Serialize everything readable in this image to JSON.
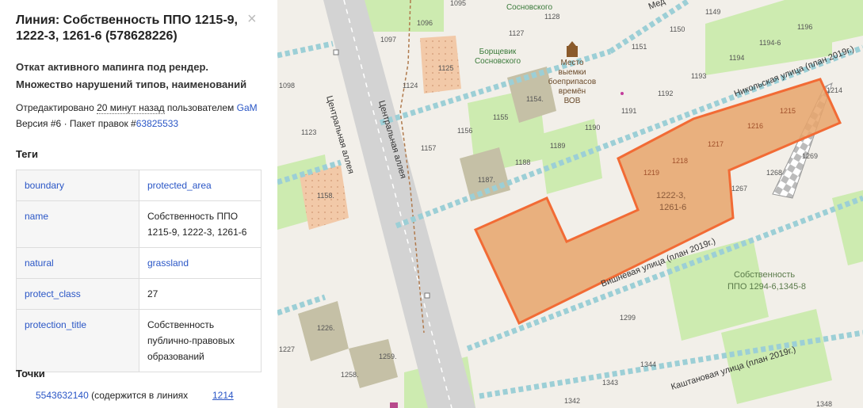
{
  "panel": {
    "title": "Линия: Собственность ППО 1215-9, 1222-3, 1261-6 (578628226)",
    "close_glyph": "×",
    "comment_line1": "Откат активного мапинга под рендер.",
    "comment_line2": "Множество нарушений типов, наименований",
    "edited_prefix": "Отредактировано",
    "edited_time": "20 минут назад",
    "edited_by": "пользователем",
    "user": "GaM",
    "version": "Версия #6",
    "changeset_prefix": "· Пакет правок #",
    "changeset": "63825533"
  },
  "tags_heading": "Теги",
  "tags": [
    {
      "key": "boundary",
      "value": "protected_area"
    },
    {
      "key": "name",
      "value": "Собственность ППО 1215-9, 1222-3, 1261-6"
    },
    {
      "key": "natural",
      "value": "grassland"
    },
    {
      "key": "protect_class",
      "value": "27"
    },
    {
      "key": "protection_title",
      "value": "Собственность публично-правовых образований"
    }
  ],
  "points_heading": "Точки",
  "point": {
    "id": "5543632140",
    "text": "(содержится в линиях",
    "other": "1214"
  },
  "map": {
    "streets": {
      "central_alley_1": "Центральная аллея",
      "central_alley_2": "Центральная аллея",
      "nikolskaya": "Никольская улица (план 2019г.)",
      "vishnevaya": "Вишневая улица (план 2019г.)",
      "kashtanovaya": "Каштановая улица (план 2019г.)",
      "med": "Мед"
    },
    "area_labels": {
      "selected_a": "1222-3,",
      "selected_b": "1261-6",
      "other_a": "Собственность",
      "other_b": "ППО 1294-6,1345-8"
    },
    "poi": {
      "l1": "Место",
      "l2": "выемки",
      "l3": "боеприпасов",
      "l4": "времён",
      "l5": "ВОВ"
    },
    "borsch": {
      "l1": "Борщевик",
      "l2": "Сосновского"
    },
    "sosn_top": "Сосновского",
    "plots": [
      "1095",
      "1128",
      "1096",
      "1097",
      "1127",
      "1125",
      "1124",
      "1154.",
      "1155",
      "1156",
      "1157",
      "1187.",
      "1188",
      "1189",
      "1190",
      "1191",
      "1192",
      "1193",
      "1194",
      "1194-6",
      "1196",
      "1149",
      "1150",
      "1151",
      "1098",
      "1123",
      "1158.",
      "1214",
      "1215",
      "1216",
      "1217",
      "1218",
      "1219",
      "1268",
      "1267",
      "1269",
      "1299",
      "1226.",
      "1227",
      "1259.",
      "1258.",
      "1344",
      "1343",
      "1342",
      "1348"
    ],
    "colors": {
      "selected_fill": "#e8a46b",
      "selected_stroke": "#f26b35",
      "grass": "#cdebb0",
      "road_dash": "#9ccfd6"
    }
  }
}
